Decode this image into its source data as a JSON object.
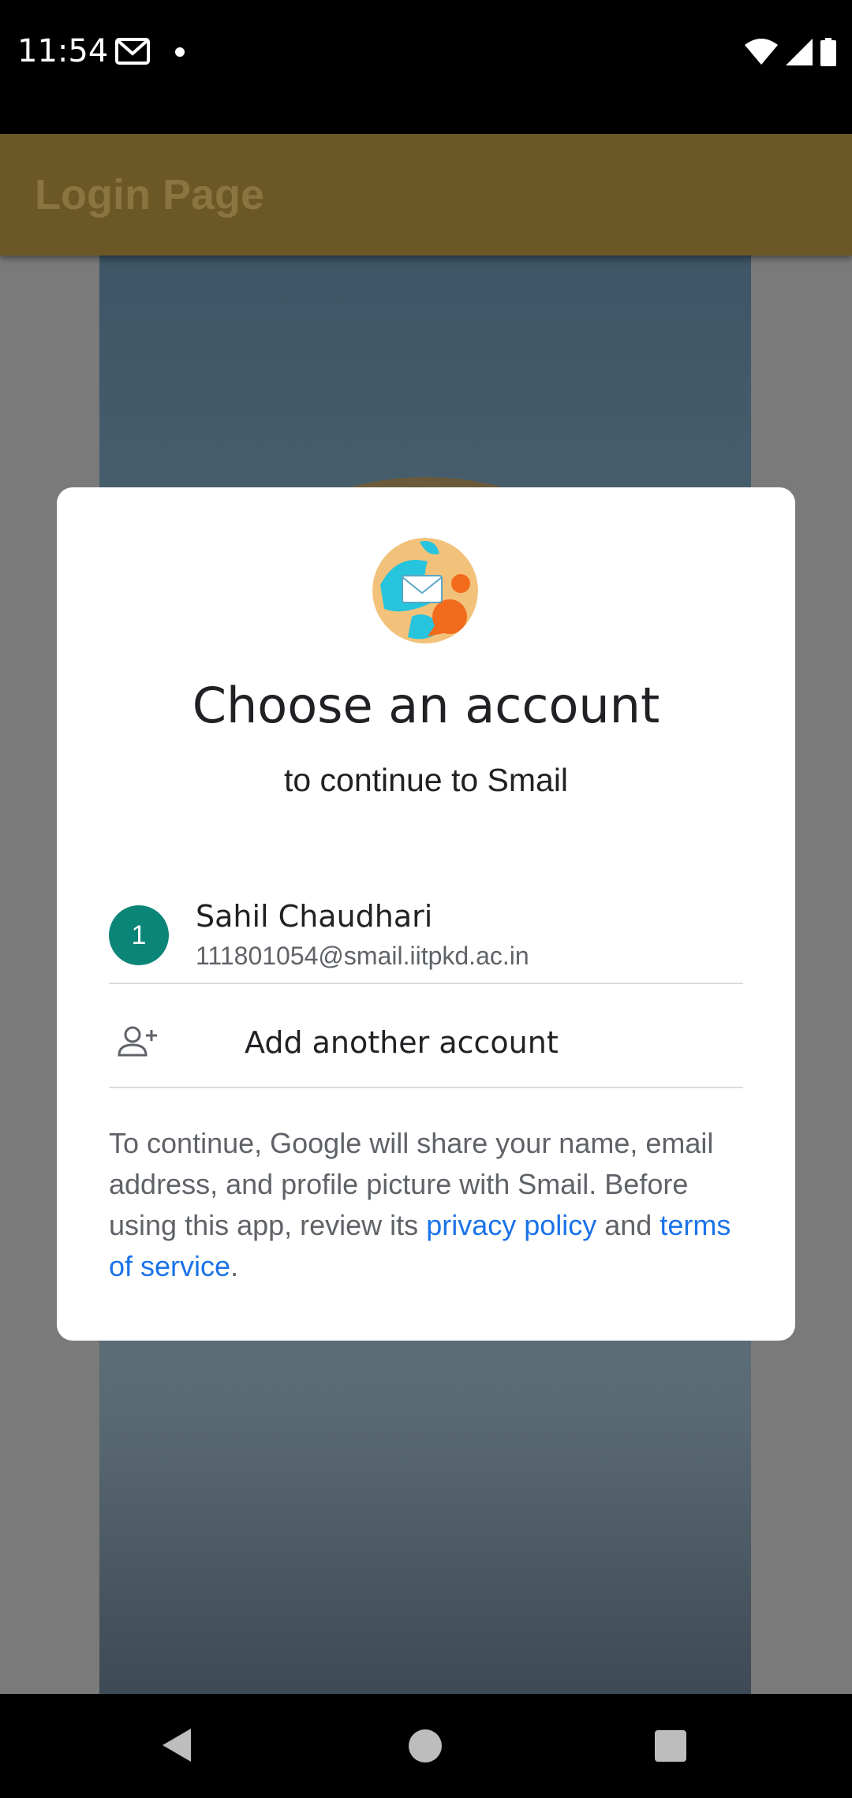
{
  "status_bar": {
    "time": "11:54"
  },
  "app": {
    "title": "Login Page"
  },
  "dialog": {
    "title": "Choose an account",
    "subtitle": "to continue to Smail",
    "account": {
      "avatar_initial": "1",
      "name": "Sahil Chaudhari",
      "email": "111801054@smail.iitpkd.ac.in"
    },
    "add_account_label": "Add another account",
    "disclaimer": {
      "text_1": "To continue, Google will share your name, email address, and profile picture with Smail. Before using this app, review its ",
      "privacy_link": "privacy policy",
      "text_2": " and ",
      "terms_link": "terms of service",
      "text_3": "."
    }
  },
  "colors": {
    "avatar": "#0b8577",
    "link": "#1a73e8",
    "app_bar": "#6b5826"
  },
  "icons": {
    "status_mail": "gmail-icon",
    "add_account": "person-add-icon",
    "app_logo": "smail-logo"
  }
}
